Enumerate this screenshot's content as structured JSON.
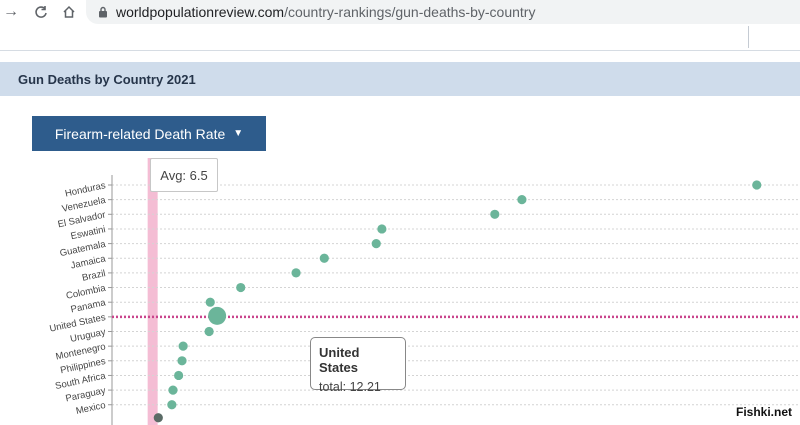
{
  "browser": {
    "url_domain": "worldpopulationreview.com",
    "url_path": "/country-rankings/gun-deaths-by-country"
  },
  "page": {
    "section_title": "Gun Deaths by Country 2021",
    "metric_button": "Firearm-related Death Rate"
  },
  "chart_data": {
    "type": "scatter",
    "avg_label": "Avg: 6.5",
    "avg": 6.5,
    "highlight_country": "United States",
    "categories": [
      "Honduras",
      "Venezuela",
      "El Salvador",
      "Eswatini",
      "Guatemala",
      "Jamaica",
      "Brazil",
      "Colombia",
      "Panama",
      "United States",
      "Uruguay",
      "Montenegro",
      "Philippines",
      "South Africa",
      "Paraguay",
      "Mexico"
    ],
    "values": [
      60.0,
      39.2,
      36.8,
      26.8,
      26.3,
      21.7,
      19.2,
      14.3,
      11.6,
      12.21,
      11.5,
      9.2,
      9.1,
      8.8,
      8.3,
      8.2
    ],
    "xlim": [
      2.9,
      62.5
    ],
    "marker_color": "#6bb59a",
    "avg_color": "#f4bdd4",
    "highlight_line_color": "#c9448c"
  },
  "tooltip": {
    "title": "United States",
    "value_text": "total: 12.21"
  },
  "watermark": "Fishki.net",
  "icons": [
    "back-arrow-icon",
    "refresh-icon",
    "home-icon",
    "lock-icon",
    "caret-down-icon"
  ]
}
